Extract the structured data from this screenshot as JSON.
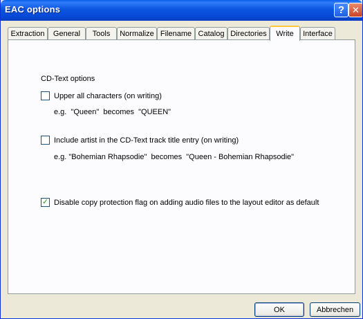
{
  "window": {
    "title": "EAC options",
    "help_glyph": "?",
    "close_glyph": "✕"
  },
  "tabs": [
    {
      "label": "Extraction"
    },
    {
      "label": "General"
    },
    {
      "label": "Tools"
    },
    {
      "label": "Normalize"
    },
    {
      "label": "Filename"
    },
    {
      "label": "Catalog"
    },
    {
      "label": "Directories"
    },
    {
      "label": "Write",
      "active": true
    },
    {
      "label": "Interface"
    }
  ],
  "cdtext": {
    "group_label": "CD-Text options",
    "options": [
      {
        "label": "Upper all characters (on writing)",
        "checked": false,
        "example": "e.g.  \"Queen\"  becomes  \"QUEEN\""
      },
      {
        "label": "Include artist in the CD-Text track title entry (on writing)",
        "checked": false,
        "example": "e.g. \"Bohemian Rhapsodie\"  becomes  \"Queen - Bohemian Rhapsodie\""
      }
    ]
  },
  "copy_protection": {
    "label": "Disable copy protection flag on adding audio files to the layout editor as default",
    "checked": true,
    "check_glyph": "✓"
  },
  "buttons": {
    "ok": "OK",
    "cancel": "Abbrechen"
  },
  "colors": {
    "titlebar": "#0a55e0",
    "active_tab_highlight": "#ffc83c",
    "check": "#21a121"
  }
}
